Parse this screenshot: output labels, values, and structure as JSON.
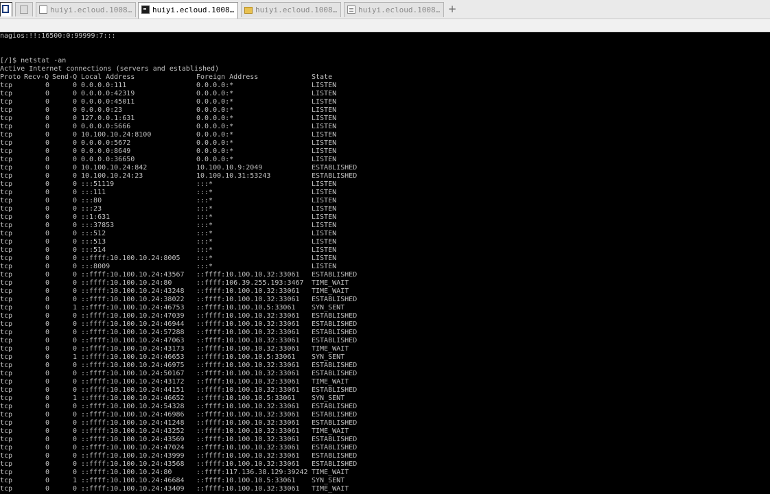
{
  "tabs": [
    {
      "label": "huiyi.ecloud.1008...",
      "icon": "page-icon",
      "active": false
    },
    {
      "label": "huiyi.ecloud.1008...",
      "icon": "terminal-icon",
      "active": true
    },
    {
      "label": "huiyi.ecloud.1008...",
      "icon": "folder-icon",
      "active": false
    },
    {
      "label": "huiyi.ecloud.1008...",
      "icon": "document-icon",
      "active": false
    }
  ],
  "new_tab_label": "+",
  "terminal": {
    "passwd_line": "nagios:!!:16500:0:99999:7:::",
    "prompt": "[/]$ netstat -an",
    "summary": "Active Internet connections (servers and established)",
    "header": {
      "proto": "Proto",
      "recvq": "Recv-Q",
      "sendq": "Send-Q",
      "local": "Local Address",
      "foreign": "Foreign Address",
      "state": "State"
    },
    "rows": [
      [
        "tcp",
        "0",
        "0",
        "0.0.0.0:111",
        "0.0.0.0:*",
        "LISTEN"
      ],
      [
        "tcp",
        "0",
        "0",
        "0.0.0.0:42319",
        "0.0.0.0:*",
        "LISTEN"
      ],
      [
        "tcp",
        "0",
        "0",
        "0.0.0.0:45011",
        "0.0.0.0:*",
        "LISTEN"
      ],
      [
        "tcp",
        "0",
        "0",
        "0.0.0.0:23",
        "0.0.0.0:*",
        "LISTEN"
      ],
      [
        "tcp",
        "0",
        "0",
        "127.0.0.1:631",
        "0.0.0.0:*",
        "LISTEN"
      ],
      [
        "tcp",
        "0",
        "0",
        "0.0.0.0:5666",
        "0.0.0.0:*",
        "LISTEN"
      ],
      [
        "tcp",
        "0",
        "0",
        "10.100.10.24:8100",
        "0.0.0.0:*",
        "LISTEN"
      ],
      [
        "tcp",
        "0",
        "0",
        "0.0.0.0:5672",
        "0.0.0.0:*",
        "LISTEN"
      ],
      [
        "tcp",
        "0",
        "0",
        "0.0.0.0:8649",
        "0.0.0.0:*",
        "LISTEN"
      ],
      [
        "tcp",
        "0",
        "0",
        "0.0.0.0:36650",
        "0.0.0.0:*",
        "LISTEN"
      ],
      [
        "tcp",
        "0",
        "0",
        "10.100.10.24:842",
        "10.100.10.9:2049",
        "ESTABLISHED"
      ],
      [
        "tcp",
        "0",
        "0",
        "10.100.10.24:23",
        "10.100.10.31:53243",
        "ESTABLISHED"
      ],
      [
        "tcp",
        "0",
        "0",
        ":::51119",
        ":::*",
        "LISTEN"
      ],
      [
        "tcp",
        "0",
        "0",
        ":::111",
        ":::*",
        "LISTEN"
      ],
      [
        "tcp",
        "0",
        "0",
        ":::80",
        ":::*",
        "LISTEN"
      ],
      [
        "tcp",
        "0",
        "0",
        ":::23",
        ":::*",
        "LISTEN"
      ],
      [
        "tcp",
        "0",
        "0",
        "::1:631",
        ":::*",
        "LISTEN"
      ],
      [
        "tcp",
        "0",
        "0",
        ":::37853",
        ":::*",
        "LISTEN"
      ],
      [
        "tcp",
        "0",
        "0",
        ":::512",
        ":::*",
        "LISTEN"
      ],
      [
        "tcp",
        "0",
        "0",
        ":::513",
        ":::*",
        "LISTEN"
      ],
      [
        "tcp",
        "0",
        "0",
        ":::514",
        ":::*",
        "LISTEN"
      ],
      [
        "tcp",
        "0",
        "0",
        "::ffff:10.100.10.24:8005",
        ":::*",
        "LISTEN"
      ],
      [
        "tcp",
        "0",
        "0",
        ":::8009",
        ":::*",
        "LISTEN"
      ],
      [
        "tcp",
        "0",
        "0",
        "::ffff:10.100.10.24:43567",
        "::ffff:10.100.10.32:33061",
        "ESTABLISHED"
      ],
      [
        "tcp",
        "0",
        "0",
        "::ffff:10.100.10.24:80",
        "::ffff:106.39.255.193:3467",
        "TIME_WAIT"
      ],
      [
        "tcp",
        "0",
        "0",
        "::ffff:10.100.10.24:43248",
        "::ffff:10.100.10.32:33061",
        "TIME_WAIT"
      ],
      [
        "tcp",
        "0",
        "0",
        "::ffff:10.100.10.24:38022",
        "::ffff:10.100.10.32:33061",
        "ESTABLISHED"
      ],
      [
        "tcp",
        "0",
        "1",
        "::ffff:10.100.10.24:46753",
        "::ffff:10.100.10.5:33061",
        "SYN_SENT"
      ],
      [
        "tcp",
        "0",
        "0",
        "::ffff:10.100.10.24:47039",
        "::ffff:10.100.10.32:33061",
        "ESTABLISHED"
      ],
      [
        "tcp",
        "0",
        "0",
        "::ffff:10.100.10.24:46944",
        "::ffff:10.100.10.32:33061",
        "ESTABLISHED"
      ],
      [
        "tcp",
        "0",
        "0",
        "::ffff:10.100.10.24:57288",
        "::ffff:10.100.10.32:33061",
        "ESTABLISHED"
      ],
      [
        "tcp",
        "0",
        "0",
        "::ffff:10.100.10.24:47063",
        "::ffff:10.100.10.32:33061",
        "ESTABLISHED"
      ],
      [
        "tcp",
        "0",
        "0",
        "::ffff:10.100.10.24:43173",
        "::ffff:10.100.10.32:33061",
        "TIME_WAIT"
      ],
      [
        "tcp",
        "0",
        "1",
        "::ffff:10.100.10.24:46653",
        "::ffff:10.100.10.5:33061",
        "SYN_SENT"
      ],
      [
        "tcp",
        "0",
        "0",
        "::ffff:10.100.10.24:46975",
        "::ffff:10.100.10.32:33061",
        "ESTABLISHED"
      ],
      [
        "tcp",
        "0",
        "0",
        "::ffff:10.100.10.24:50167",
        "::ffff:10.100.10.32:33061",
        "ESTABLISHED"
      ],
      [
        "tcp",
        "0",
        "0",
        "::ffff:10.100.10.24:43172",
        "::ffff:10.100.10.32:33061",
        "TIME_WAIT"
      ],
      [
        "tcp",
        "0",
        "0",
        "::ffff:10.100.10.24:44151",
        "::ffff:10.100.10.32:33061",
        "ESTABLISHED"
      ],
      [
        "tcp",
        "0",
        "1",
        "::ffff:10.100.10.24:46652",
        "::ffff:10.100.10.5:33061",
        "SYN_SENT"
      ],
      [
        "tcp",
        "0",
        "0",
        "::ffff:10.100.10.24:54328",
        "::ffff:10.100.10.32:33061",
        "ESTABLISHED"
      ],
      [
        "tcp",
        "0",
        "0",
        "::ffff:10.100.10.24:46986",
        "::ffff:10.100.10.32:33061",
        "ESTABLISHED"
      ],
      [
        "tcp",
        "0",
        "0",
        "::ffff:10.100.10.24:41248",
        "::ffff:10.100.10.32:33061",
        "ESTABLISHED"
      ],
      [
        "tcp",
        "0",
        "0",
        "::ffff:10.100.10.24:43252",
        "::ffff:10.100.10.32:33061",
        "TIME_WAIT"
      ],
      [
        "tcp",
        "0",
        "0",
        "::ffff:10.100.10.24:43569",
        "::ffff:10.100.10.32:33061",
        "ESTABLISHED"
      ],
      [
        "tcp",
        "0",
        "0",
        "::ffff:10.100.10.24:47024",
        "::ffff:10.100.10.32:33061",
        "ESTABLISHED"
      ],
      [
        "tcp",
        "0",
        "0",
        "::ffff:10.100.10.24:43999",
        "::ffff:10.100.10.32:33061",
        "ESTABLISHED"
      ],
      [
        "tcp",
        "0",
        "0",
        "::ffff:10.100.10.24:43568",
        "::ffff:10.100.10.32:33061",
        "ESTABLISHED"
      ],
      [
        "tcp",
        "0",
        "0",
        "::ffff:10.100.10.24:80",
        "::ffff:117.136.38.129:39242",
        "TIME_WAIT"
      ],
      [
        "tcp",
        "0",
        "1",
        "::ffff:10.100.10.24:46684",
        "::ffff:10.100.10.5:33061",
        "SYN_SENT"
      ],
      [
        "tcp",
        "0",
        "0",
        "::ffff:10.100.10.24:43409",
        "::ffff:10.100.10.32:33061",
        "TIME_WAIT"
      ]
    ]
  }
}
